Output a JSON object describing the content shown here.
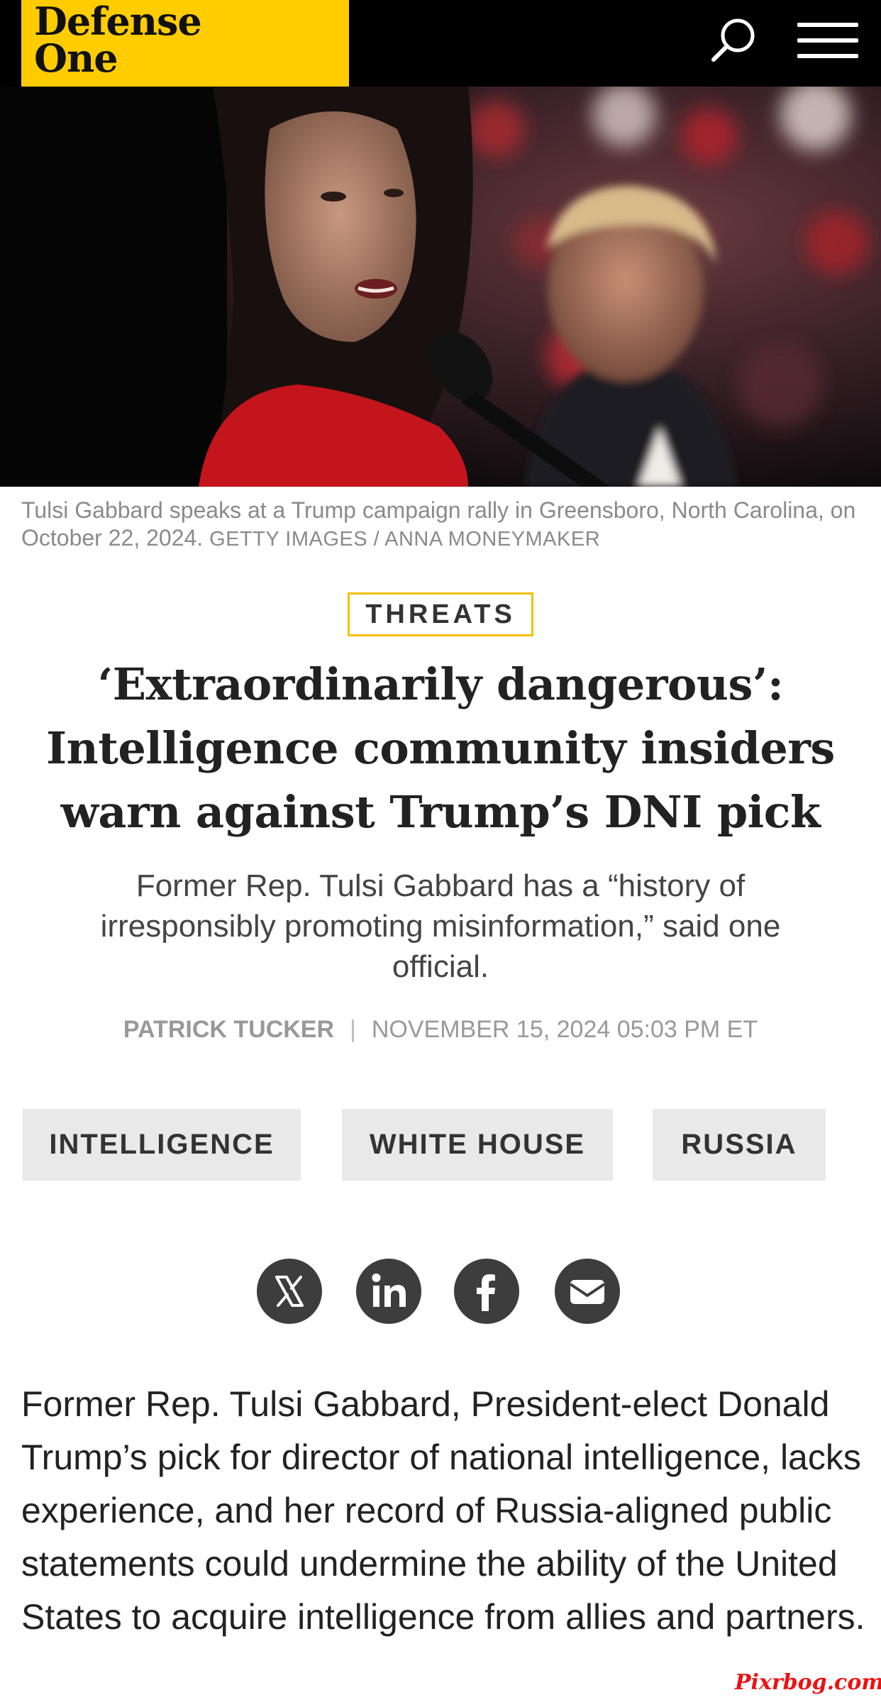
{
  "header": {
    "logo_line1": "Defense",
    "logo_line2": "One",
    "brand_color": "#ffcc00",
    "icons": [
      "search-icon",
      "hamburger-menu-icon"
    ]
  },
  "hero": {
    "caption_text": "Tulsi Gabbard speaks at a Trump campaign rally in Greensboro, North Carolina, on October 22, 2024.",
    "caption_credit": "Getty Images / Anna Moneymaker"
  },
  "article": {
    "section_label": "THREATS",
    "headline": "‘Extraordinarily dangerous’: Intelligence community insiders warn against Trump’s DNI pick",
    "dek": "Former Rep. Tulsi Gabbard has a “history of irresponsibly promoting misinformation,” said one official.",
    "author": "PATRICK TUCKER",
    "separator": "|",
    "date": "NOVEMBER 15, 2024 05:03 PM ET",
    "topics": [
      "INTELLIGENCE",
      "WHITE HOUSE",
      "RUSSIA"
    ],
    "share_icons": [
      "x-icon",
      "linkedin-icon",
      "facebook-icon",
      "email-icon"
    ],
    "body": "Former Rep. Tulsi Gabbard, President-elect Donald Trump’s pick for director of national intelligence, lacks experience, and her record of Russia-aligned public statements could undermine the ability of the United States to acquire intelligence from allies and partners."
  },
  "watermark": "Pixrbog.com"
}
